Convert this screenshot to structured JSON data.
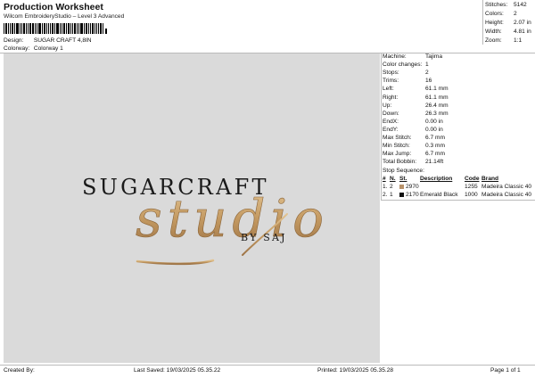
{
  "header": {
    "title": "Production Worksheet",
    "subtitle": "Wilcom EmbroideryStudio – Level 3 Advanced"
  },
  "meta": {
    "design_label": "Design:",
    "design_value": "SUGAR CRAFT 4,8IN",
    "colorway_label": "Colorway:",
    "colorway_value": "Colorway 1"
  },
  "summary": [
    {
      "label": "Stitches:",
      "value": "5142"
    },
    {
      "label": "Colors:",
      "value": "2"
    },
    {
      "label": "Height:",
      "value": "2.07 in"
    },
    {
      "label": "Width:",
      "value": "4.81 in"
    },
    {
      "label": "Zoom:",
      "value": "1:1"
    }
  ],
  "details": [
    {
      "label": "Machine:",
      "value": "Tajima"
    },
    {
      "label": "Color changes:",
      "value": "1"
    },
    {
      "label": "Stops:",
      "value": "2"
    },
    {
      "label": "Trims:",
      "value": "16"
    },
    {
      "label": "Left:",
      "value": "61.1 mm"
    },
    {
      "label": "Right:",
      "value": "61.1 mm"
    },
    {
      "label": "Up:",
      "value": "26.4 mm"
    },
    {
      "label": "Down:",
      "value": "26.3 mm"
    },
    {
      "label": "EndX:",
      "value": "0.00 in"
    },
    {
      "label": "EndY:",
      "value": "0.00 in"
    },
    {
      "label": "Max Stitch:",
      "value": "6.7 mm"
    },
    {
      "label": "Min Stitch:",
      "value": "0.3 mm"
    },
    {
      "label": "Max Jump:",
      "value": "6.7 mm"
    },
    {
      "label": "Total Bobbin:",
      "value": "21.14ft"
    }
  ],
  "stop_sequence": {
    "title": "Stop Sequence:",
    "headers": [
      "#",
      "N.",
      "St.",
      "Description",
      "Code",
      "Brand"
    ],
    "rows": [
      {
        "num": "1.",
        "n": "2",
        "st": "2970",
        "description": "",
        "code": "1255",
        "brand": "Madeira Classic 40",
        "color": "#b8926a"
      },
      {
        "num": "2.",
        "n": "1",
        "st": "2170",
        "description": "Emerald Black",
        "code": "1000",
        "brand": "Madeira Classic 40",
        "color": "#111111"
      }
    ]
  },
  "design_preview": {
    "word_top": "SUGARCRAFT",
    "word_script": "studio",
    "word_small": "BY SAJ",
    "colors": {
      "gold": "#c9a46e",
      "black": "#1a1a1a",
      "background": "#dadada"
    }
  },
  "footer": {
    "created_by": "Created By:",
    "last_saved": "Last Saved: 19/03/2025 05.35.22",
    "printed": "Printed: 19/03/2025 05.35.28",
    "page": "Page 1 of 1"
  }
}
